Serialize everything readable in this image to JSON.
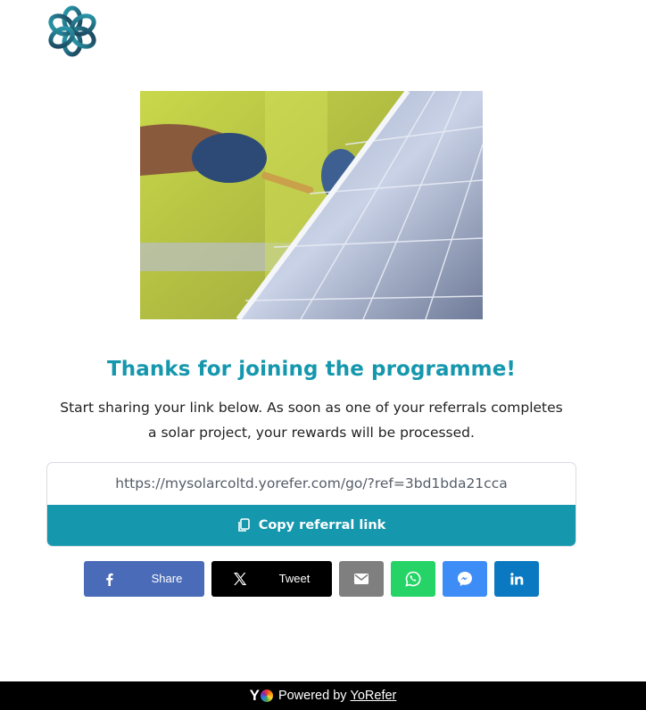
{
  "logo": {
    "icon": "flower-knot-logo"
  },
  "hero": {
    "image": "technician-installing-solar-panel"
  },
  "heading": "Thanks for joining the programme!",
  "subtitle": "Start sharing your link below. As soon as one of your referrals completes a solar project, your rewards will be processed.",
  "referral": {
    "url": "https://mysolarcoltd.yorefer.com/go/?ref=3bd1bda21cca",
    "copy_label": "Copy referral link",
    "copy_icon": "copy-icon"
  },
  "share": {
    "facebook_label": "Share",
    "twitter_label": "Tweet",
    "buttons": [
      {
        "name": "facebook",
        "icon": "facebook-icon",
        "color": "#4a6bb8"
      },
      {
        "name": "x",
        "icon": "x-icon",
        "color": "#000000"
      },
      {
        "name": "email",
        "icon": "email-icon",
        "color": "#7f7f7f"
      },
      {
        "name": "whatsapp",
        "icon": "whatsapp-icon",
        "color": "#25d366"
      },
      {
        "name": "messenger",
        "icon": "messenger-icon",
        "color": "#3e8cf6"
      },
      {
        "name": "linkedin",
        "icon": "linkedin-icon",
        "color": "#0a79c1"
      }
    ]
  },
  "footer": {
    "brand_letter": "Y",
    "powered_by": "Powered by",
    "brand_link": "YoRefer"
  },
  "colors": {
    "accent": "#1597ad",
    "footer_bg": "#000000"
  }
}
